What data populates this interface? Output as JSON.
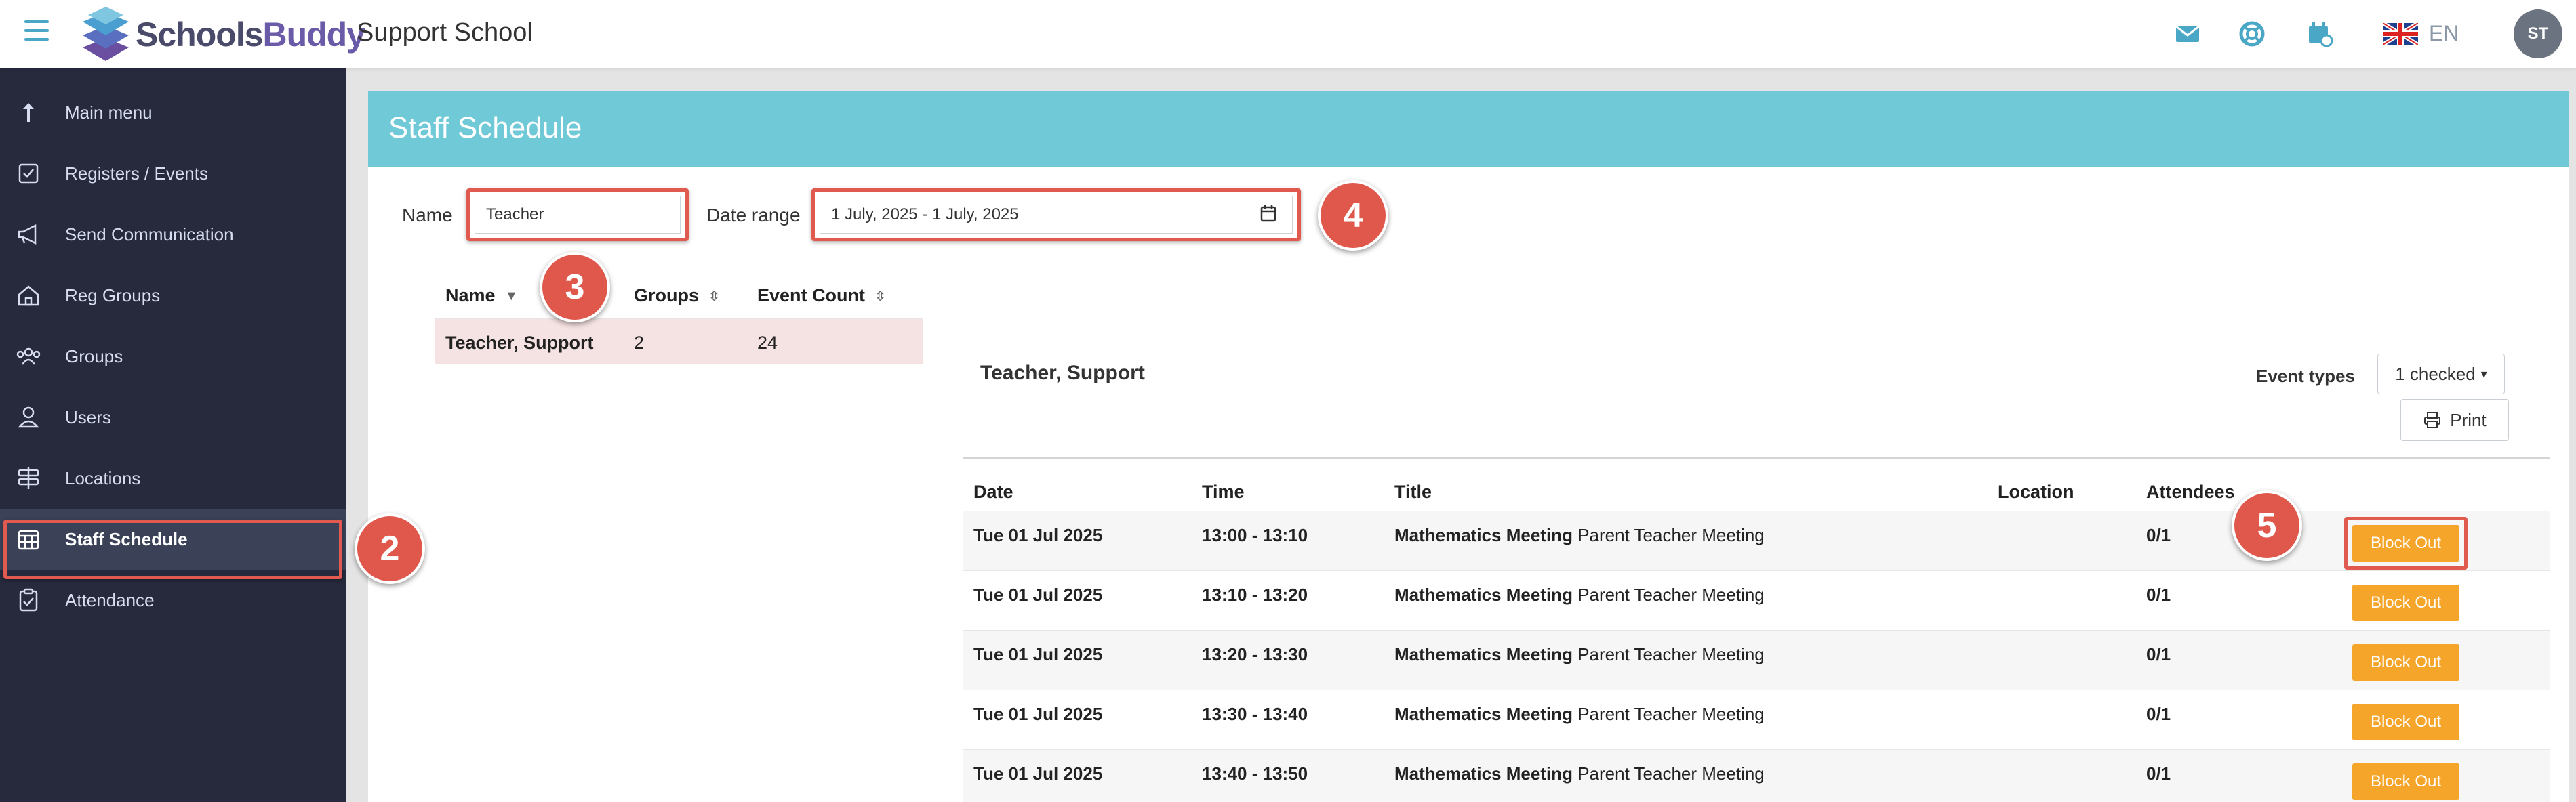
{
  "app": {
    "brand_part1": "Schools",
    "brand_part2": "Buddy",
    "school_name": "Support School",
    "language": "EN",
    "avatar_initials": "ST",
    "icons": [
      "menu-icon",
      "mail-icon",
      "help-icon",
      "calendar-settings-icon",
      "uk-flag-icon"
    ]
  },
  "sidebar": {
    "items": [
      {
        "label": "Main menu",
        "icon": "arrow-up-icon"
      },
      {
        "label": "Registers / Events",
        "icon": "checkbox-icon"
      },
      {
        "label": "Send Communication",
        "icon": "megaphone-icon"
      },
      {
        "label": "Reg Groups",
        "icon": "home-icon"
      },
      {
        "label": "Groups",
        "icon": "people-icon"
      },
      {
        "label": "Users",
        "icon": "user-icon"
      },
      {
        "label": "Locations",
        "icon": "signpost-icon"
      },
      {
        "label": "Staff Schedule",
        "icon": "calendar-grid-icon",
        "active": true
      },
      {
        "label": "Attendance",
        "icon": "clipboard-icon"
      }
    ]
  },
  "page": {
    "title": "Staff Schedule",
    "filters": {
      "name_label": "Name",
      "name_value": "Teacher",
      "date_range_label": "Date range",
      "date_range_value": "1 July, 2025 - 1 July, 2025"
    }
  },
  "name_table": {
    "columns": [
      "Name",
      "Groups",
      "Event Count"
    ],
    "rows": [
      {
        "name": "Teacher, Support",
        "groups": "2",
        "event_count": "24"
      }
    ]
  },
  "schedule": {
    "staff_name": "Teacher, Support",
    "event_types_label": "Event types",
    "event_types_value": "1 checked",
    "print_label": "Print",
    "columns": [
      "Date",
      "Time",
      "Title",
      "Location",
      "Attendees"
    ],
    "rows": [
      {
        "date": "Tue 01 Jul 2025",
        "time": "13:00 - 13:10",
        "title_bold": "Mathematics Meeting",
        "title_rest": "Parent Teacher Meeting",
        "location": "",
        "attendees": "0/1",
        "action": "Block Out"
      },
      {
        "date": "Tue 01 Jul 2025",
        "time": "13:10 - 13:20",
        "title_bold": "Mathematics Meeting",
        "title_rest": "Parent Teacher Meeting",
        "location": "",
        "attendees": "0/1",
        "action": "Block Out"
      },
      {
        "date": "Tue 01 Jul 2025",
        "time": "13:20 - 13:30",
        "title_bold": "Mathematics Meeting",
        "title_rest": "Parent Teacher Meeting",
        "location": "",
        "attendees": "0/1",
        "action": "Block Out"
      },
      {
        "date": "Tue 01 Jul 2025",
        "time": "13:30 - 13:40",
        "title_bold": "Mathematics Meeting",
        "title_rest": "Parent Teacher Meeting",
        "location": "",
        "attendees": "0/1",
        "action": "Block Out"
      },
      {
        "date": "Tue 01 Jul 2025",
        "time": "13:40 - 13:50",
        "title_bold": "Mathematics Meeting",
        "title_rest": "Parent Teacher Meeting",
        "location": "",
        "attendees": "0/1",
        "action": "Block Out"
      }
    ]
  },
  "callouts": [
    "2",
    "3",
    "4",
    "5"
  ],
  "colors": {
    "sidebar_bg": "#262a3c",
    "header_teal": "#6fc9d6",
    "accent_orange": "#f5a529",
    "callout_red": "#e0584c"
  }
}
